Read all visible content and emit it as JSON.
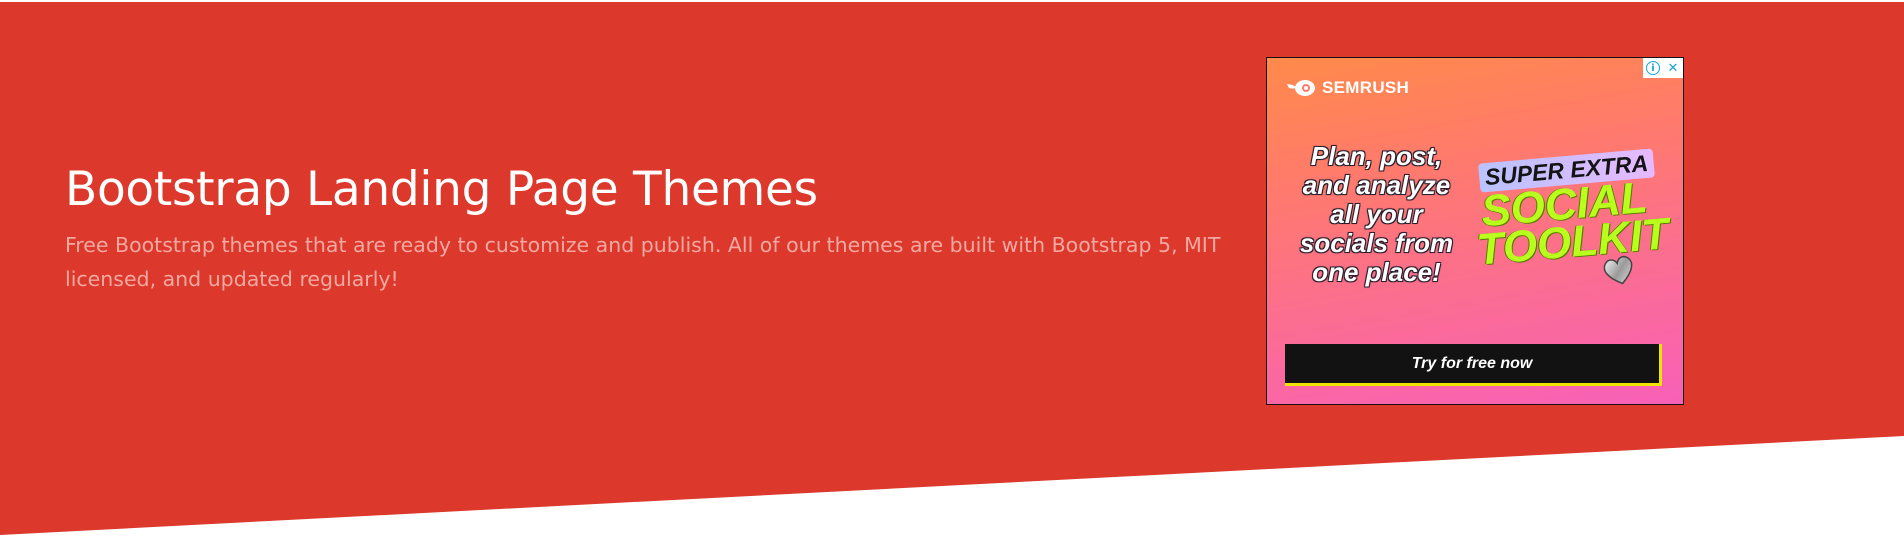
{
  "colors": {
    "hero_background": "#dc382b",
    "subtitle_text": "#f3a9a1",
    "cta_background": "#121212",
    "cta_border": "#f2e200"
  },
  "hero": {
    "title": "Bootstrap Landing Page Themes",
    "subtitle": "Free Bootstrap themes that are ready to customize and publish. All of our themes are built with Bootstrap 5, MIT licensed, and updated regularly!"
  },
  "ad": {
    "info_icon": "i",
    "close_icon": "✕",
    "brand": "SEMRUSH",
    "headline_lines": [
      "Plan, post,",
      "and analyze",
      "all your",
      "socials from",
      "one place!"
    ],
    "super_extra": "SUPER EXTRA",
    "social_toolkit_lines": [
      "SOCIAL",
      "TOOLKIT"
    ],
    "cta_label": "Try for free now"
  }
}
